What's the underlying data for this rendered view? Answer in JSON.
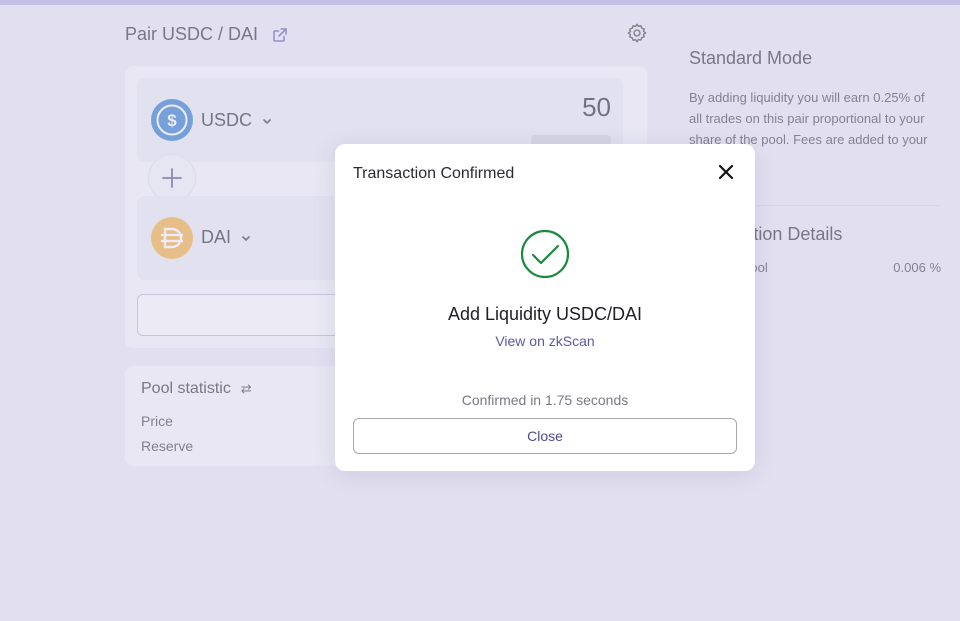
{
  "pair": {
    "title": "Pair USDC / DAI"
  },
  "tokens": [
    {
      "symbol": "USDC",
      "amount": "50",
      "icon": "usdc-coin-icon",
      "color": "#2775ca"
    },
    {
      "symbol": "DAI",
      "amount": "",
      "icon": "dai-coin-icon",
      "color": "#f5ac37"
    }
  ],
  "pool": {
    "title": "Pool statistic",
    "rows": [
      {
        "label": "Price"
      },
      {
        "label": "Reserve"
      }
    ]
  },
  "side": {
    "mode_title": "Standard Mode",
    "mode_text": "By adding liquidity you will earn 0.25% of all trades on this pair proportional to your share of the pool. Fees are added to your principal in",
    "details_title": "Transaction Details",
    "details_rows": [
      {
        "label": "Share of Pool",
        "value": "0.006 %"
      }
    ]
  },
  "modal": {
    "title": "Transaction Confirmed",
    "heading": "Add Liquidity USDC/DAI",
    "link": "View on zkScan",
    "confirmed": "Confirmed in 1.75 seconds",
    "close_label": "Close",
    "success_color": "#1a8a3c"
  }
}
